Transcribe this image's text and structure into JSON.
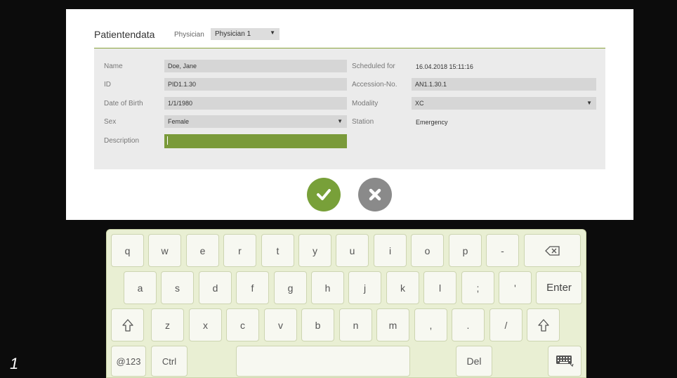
{
  "dialog": {
    "title": "Patientendata",
    "physician_label": "Physician",
    "physician_value": "Physician 1",
    "fields": {
      "name_label": "Name",
      "name_value": "Doe, Jane",
      "id_label": "ID",
      "id_value": "PID1.1.30",
      "dob_label": "Date of Birth",
      "dob_value": "1/1/1980",
      "sex_label": "Sex",
      "sex_value": "Female",
      "description_label": "Description",
      "description_value": "",
      "scheduled_label": "Scheduled for",
      "scheduled_value": "16.04.2018 15:11:16",
      "accession_label": "Accession-No.",
      "accession_value": "AN1.1.30.1",
      "modality_label": "Modality",
      "modality_value": "XC",
      "station_label": "Station",
      "station_value": "Emergency"
    },
    "ok_icon": "check-icon",
    "cancel_icon": "x-icon"
  },
  "keyboard": {
    "row1": [
      "q",
      "w",
      "e",
      "r",
      "t",
      "y",
      "u",
      "i",
      "o",
      "p",
      "-"
    ],
    "row2": [
      "a",
      "s",
      "d",
      "f",
      "g",
      "h",
      "j",
      "k",
      "l",
      ";",
      "'",
      "Enter"
    ],
    "row3": [
      "z",
      "x",
      "c",
      "v",
      "b",
      "n",
      "m",
      ",",
      ".",
      "/"
    ],
    "row4": [
      "@123",
      "Ctrl",
      "Del"
    ]
  },
  "figure_number": "1",
  "colors": {
    "accent": "#78a039",
    "cancel": "#8a8a8a",
    "keyboard_bg": "#e9efd3"
  }
}
